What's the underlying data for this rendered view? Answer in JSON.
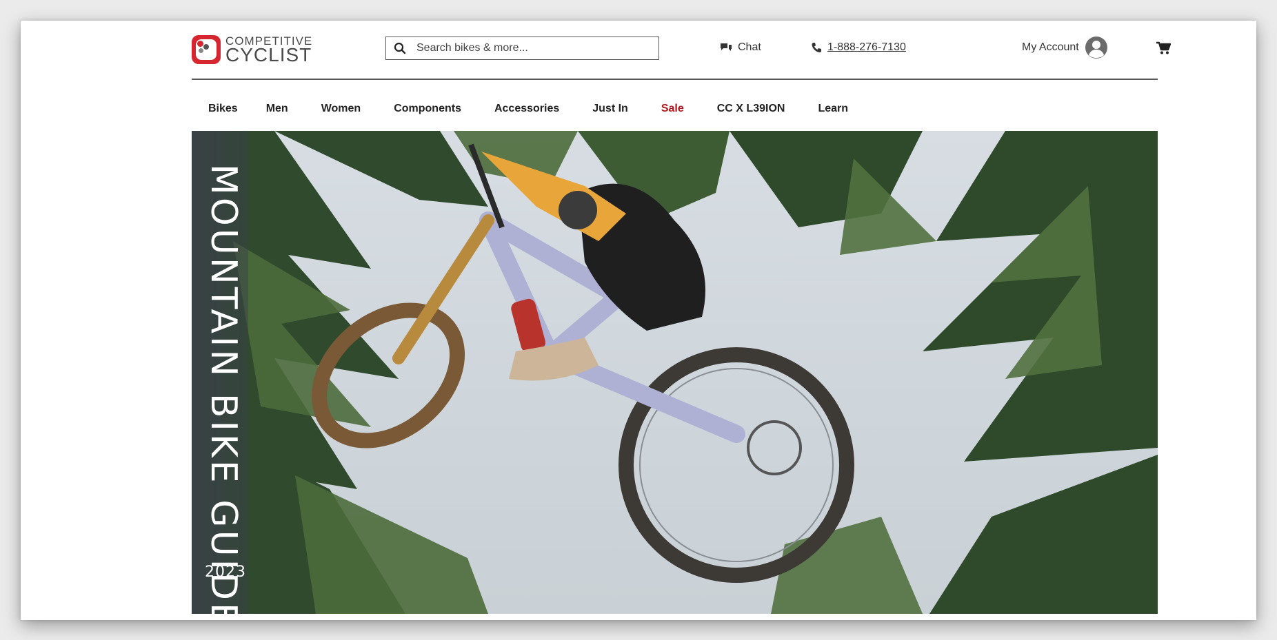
{
  "header": {
    "logo_top": "COMPETITIVE",
    "logo_bottom": "CYCLIST",
    "search_placeholder": "Search bikes & more...",
    "chat_label": "Chat",
    "phone": "1-888-276-7130",
    "account_label": "My Account"
  },
  "nav": {
    "items": [
      "Bikes",
      "Men",
      "Women",
      "Components",
      "Accessories",
      "Just In",
      "Sale",
      "CC X L39ION",
      "Learn"
    ]
  },
  "hero": {
    "title": "MOUNTAIN BIKE GUIDE",
    "year": "2023"
  },
  "colors": {
    "brand_red": "#d6262f",
    "sale_red": "#b0161c",
    "text": "#333333"
  },
  "icons": [
    "search-icon",
    "chat-icon",
    "phone-icon",
    "account-icon",
    "cart-icon"
  ]
}
